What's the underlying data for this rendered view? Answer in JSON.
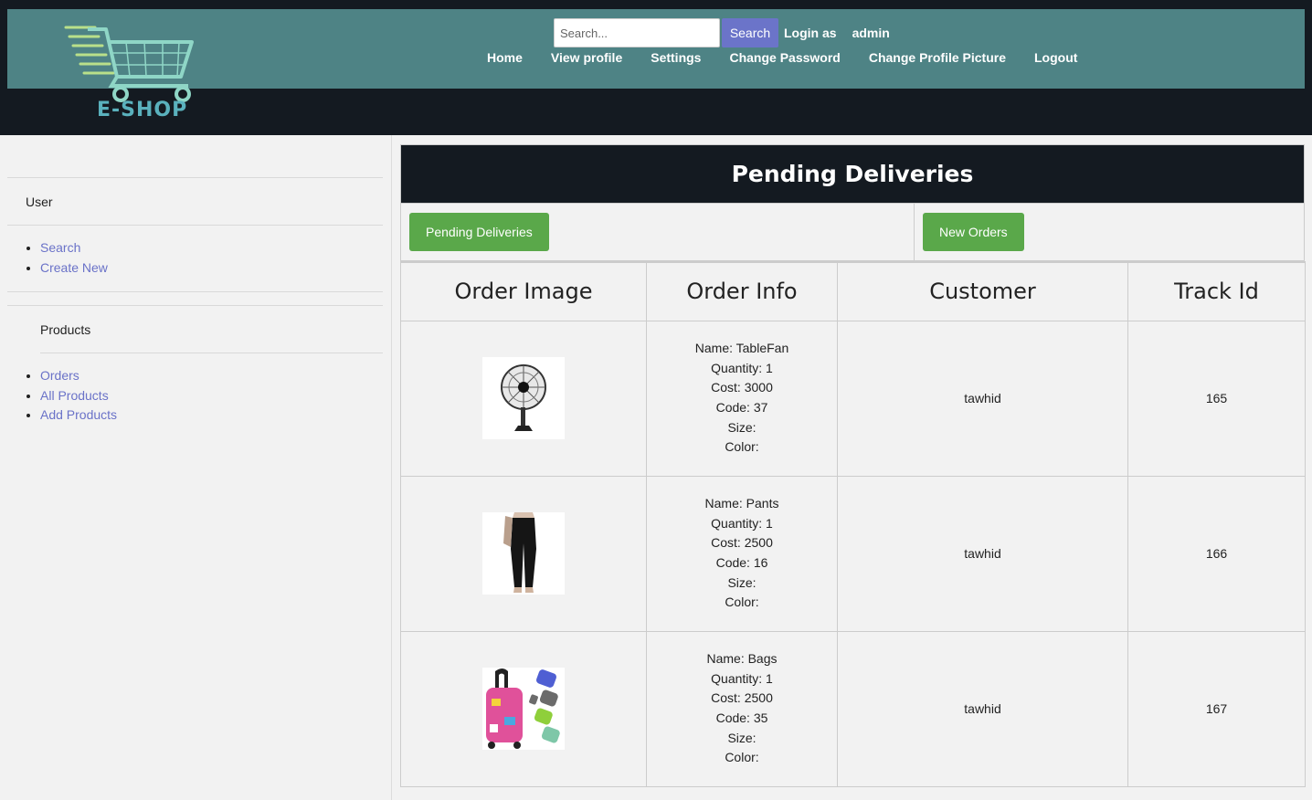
{
  "header": {
    "logo_text": "E-SHOP",
    "search_placeholder": "Search...",
    "search_button": "Search",
    "login_as_label": "Login as",
    "username": "admin",
    "nav": [
      "Home",
      "View profile",
      "Settings",
      "Change Password",
      "Change Profile Picture",
      "Logout"
    ]
  },
  "sidebar": {
    "user_heading": "User",
    "user_links": [
      "Search",
      "Create New"
    ],
    "products_heading": "Products",
    "product_links": [
      "Orders",
      "All Products",
      "Add Products"
    ]
  },
  "main": {
    "title": "Pending Deliveries",
    "buttons": [
      "Pending Deliveries",
      "New Orders"
    ],
    "columns": [
      "Order Image",
      "Order Info",
      "Customer",
      "Track Id"
    ],
    "rows": [
      {
        "image_icon": "table-fan-image",
        "info": [
          "Name: TableFan",
          "Quantity: 1",
          "Cost: 3000",
          "Code: 37",
          "Size:",
          "Color:"
        ],
        "customer": "tawhid",
        "track_id": "165"
      },
      {
        "image_icon": "pants-image",
        "info": [
          "Name: Pants",
          "Quantity: 1",
          "Cost: 2500",
          "Code: 16",
          "Size:",
          "Color:"
        ],
        "customer": "tawhid",
        "track_id": "166"
      },
      {
        "image_icon": "bags-image",
        "info": [
          "Name: Bags",
          "Quantity: 1",
          "Cost: 2500",
          "Code: 35",
          "Size:",
          "Color:"
        ],
        "customer": "tawhid",
        "track_id": "167"
      }
    ]
  },
  "colors": {
    "header_dark": "#141a21",
    "header_band": "#4e8385",
    "search_button": "#6b74c9",
    "link": "#6a72c8",
    "green_button": "#5aa84a",
    "background": "#f2f2f2"
  }
}
